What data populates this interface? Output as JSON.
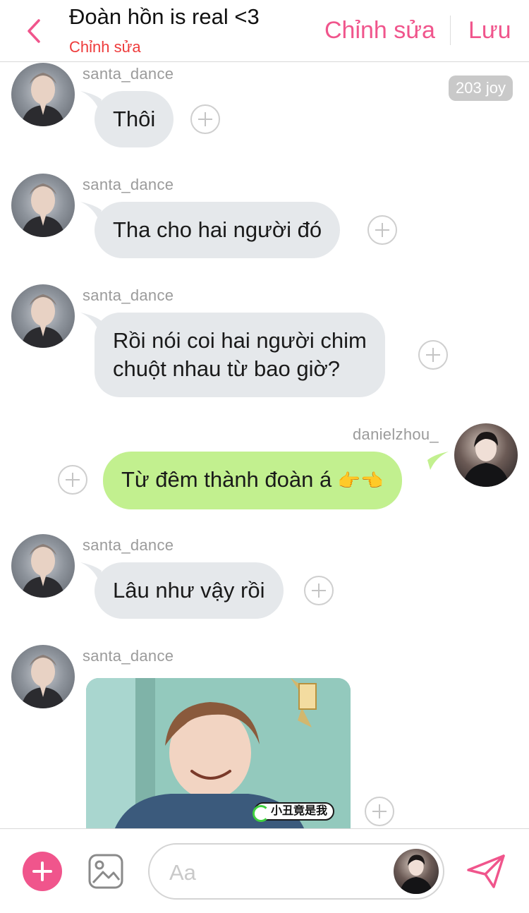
{
  "header": {
    "title": "Đoàn hồn is real <3",
    "subtitle": "Chỉnh sửa",
    "edit_label": "Chỉnh sửa",
    "save_label": "Lưu"
  },
  "joy_badge": "203 joy",
  "messages": [
    {
      "user": "santa_dance",
      "text": "Thôi"
    },
    {
      "user": "santa_dance",
      "text": "Tha cho hai người đó"
    },
    {
      "user": "santa_dance",
      "text_line1": "Rồi nói coi hai người chim",
      "text_line2": "chuột nhau từ bao giờ?"
    },
    {
      "user": "danielzhou_",
      "text": "Từ đêm thành đoàn á",
      "emoji": "👉👈"
    },
    {
      "user": "santa_dance",
      "text": "Lâu như vậy rồi"
    },
    {
      "user": "santa_dance",
      "media_caption": "小丑竟是我"
    }
  ],
  "composer": {
    "placeholder": "Aa"
  },
  "colors": {
    "accent": "#f0558c",
    "subtitle_red": "#ee3b3b",
    "bubble_gray": "#e5e8eb",
    "bubble_green": "#c2f08f"
  }
}
